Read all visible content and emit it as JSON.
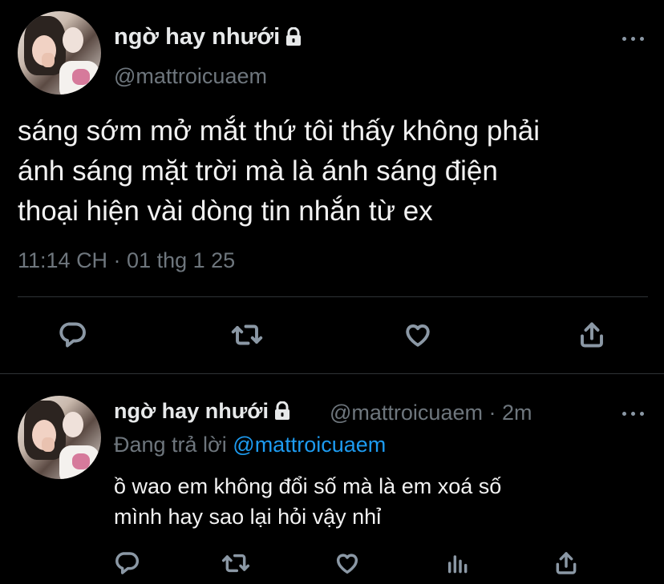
{
  "main_tweet": {
    "display_name": "ngờ hay nhưới",
    "handle": "@mattroicuaem",
    "text_lines": [
      "sáng sớm mở mắt thứ tôi thấy không phải",
      "ánh sáng mặt trời mà là ánh sáng điện",
      "thoại hiện vài dòng tin nhắn từ ex"
    ],
    "timestamp": "11:14 CH · 01 thg 1 25",
    "actions": [
      "reply-icon",
      "retweet-icon",
      "like-icon",
      "share-icon"
    ]
  },
  "reply_tweet": {
    "display_name": "ngờ hay nhưới",
    "handle_time": "@mattroicuaem · 2m",
    "replying_prefix": "Đang trả lời",
    "replying_to": "@mattroicuaem",
    "text_lines": [
      "ồ wao em không đổi số mà là em xoá số",
      "mình hay sao lại hỏi vậy nhỉ"
    ],
    "actions": [
      "reply-icon",
      "retweet-icon",
      "like-icon",
      "analytics-icon",
      "share-icon"
    ]
  },
  "colors": {
    "background": "#000000",
    "text": "#f2f2f2",
    "muted": "#6e767d",
    "link": "#1d9bf0",
    "divider": "#2f3336"
  }
}
